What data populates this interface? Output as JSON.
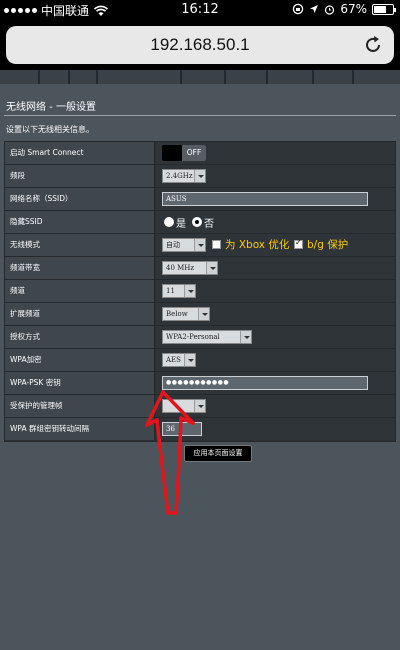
{
  "status_bar": {
    "carrier": "中国联通",
    "time": "16:12",
    "battery": "67%",
    "battery_level": 0.67
  },
  "browser": {
    "url": "192.168.50.1"
  },
  "page": {
    "title": "无线网络 - 一般设置",
    "subtitle": "设置以下无线相关信息。",
    "rows": {
      "smart_connect": {
        "label": "启动 Smart Connect",
        "toggle": "OFF"
      },
      "band": {
        "label": "频段",
        "value": "2.4GHz"
      },
      "ssid": {
        "label": "网络名称（SSID）",
        "value": "ASUS"
      },
      "hide_ssid": {
        "label": "隐藏SSID",
        "yes": "是",
        "no": "否",
        "selected": "否"
      },
      "wireless_mode": {
        "label": "无线模式",
        "value": "自动",
        "xbox_label": "为 Xbox 优化",
        "bg_label": "b/g 保护",
        "xbox_checked": false,
        "bg_checked": true
      },
      "bandwidth": {
        "label": "频道带宽",
        "value": "40 MHz"
      },
      "channel": {
        "label": "频道",
        "value": "11"
      },
      "ext_channel": {
        "label": "扩展频道",
        "value": "Below"
      },
      "auth": {
        "label": "授权方式",
        "value": "WPA2-Personal"
      },
      "encryption": {
        "label": "WPA加密",
        "value": "AES"
      },
      "psk": {
        "label": "WPA-PSK 密钥",
        "value": "●●●●●●●●●●●"
      },
      "pmf": {
        "label": "受保护的管理帧",
        "value": ""
      },
      "group_key": {
        "label": "WPA 群组密钥转动间隔",
        "value": "36"
      }
    },
    "apply_button": "应用本页面设置"
  },
  "colors": {
    "page_bg": "#4d555c",
    "annotation_arrow": "#e0161c",
    "highlight_text": "#ffcc00"
  }
}
